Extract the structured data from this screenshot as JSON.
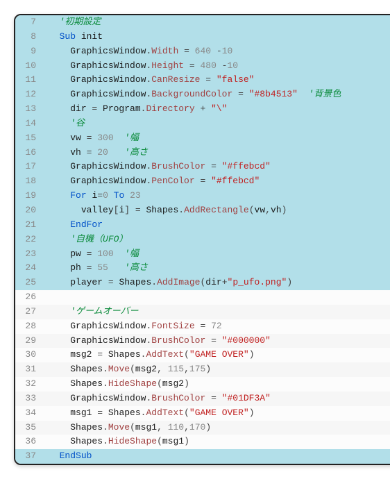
{
  "lines": [
    {
      "num": 7,
      "hl": true,
      "indent": 1,
      "tokens": [
        [
          "comment",
          "'初期設定"
        ]
      ]
    },
    {
      "num": 8,
      "hl": true,
      "indent": 1,
      "tokens": [
        [
          "keyword",
          "Sub "
        ],
        [
          "ident",
          "init"
        ]
      ]
    },
    {
      "num": 9,
      "hl": true,
      "indent": 2,
      "tokens": [
        [
          "ident",
          "GraphicsWindow"
        ],
        [
          "op",
          "."
        ],
        [
          "prop",
          "Width"
        ],
        [
          "op",
          " = "
        ],
        [
          "num",
          "640"
        ],
        [
          "op",
          " -"
        ],
        [
          "num",
          "10"
        ]
      ]
    },
    {
      "num": 10,
      "hl": true,
      "indent": 2,
      "tokens": [
        [
          "ident",
          "GraphicsWindow"
        ],
        [
          "op",
          "."
        ],
        [
          "prop",
          "Height"
        ],
        [
          "op",
          " = "
        ],
        [
          "num",
          "480"
        ],
        [
          "op",
          " -"
        ],
        [
          "num",
          "10"
        ]
      ]
    },
    {
      "num": 11,
      "hl": true,
      "indent": 2,
      "tokens": [
        [
          "ident",
          "GraphicsWindow"
        ],
        [
          "op",
          "."
        ],
        [
          "prop",
          "CanResize"
        ],
        [
          "op",
          " = "
        ],
        [
          "str",
          "\"false\""
        ]
      ]
    },
    {
      "num": 12,
      "hl": true,
      "indent": 2,
      "tokens": [
        [
          "ident",
          "GraphicsWindow"
        ],
        [
          "op",
          "."
        ],
        [
          "prop",
          "BackgroundColor"
        ],
        [
          "op",
          " = "
        ],
        [
          "str",
          "\"#8b4513\""
        ],
        [
          "op",
          "  "
        ],
        [
          "comment",
          "'背景色"
        ]
      ]
    },
    {
      "num": 13,
      "hl": true,
      "indent": 2,
      "tokens": [
        [
          "ident",
          "dir"
        ],
        [
          "op",
          " = "
        ],
        [
          "ident",
          "Program"
        ],
        [
          "op",
          "."
        ],
        [
          "prop",
          "Directory"
        ],
        [
          "op",
          " + "
        ],
        [
          "str",
          "\"\\\""
        ]
      ]
    },
    {
      "num": 14,
      "hl": true,
      "indent": 2,
      "tokens": [
        [
          "comment",
          "'谷"
        ]
      ]
    },
    {
      "num": 15,
      "hl": true,
      "indent": 2,
      "tokens": [
        [
          "ident",
          "vw"
        ],
        [
          "op",
          " = "
        ],
        [
          "num",
          "300"
        ],
        [
          "op",
          "  "
        ],
        [
          "comment",
          "'幅"
        ]
      ]
    },
    {
      "num": 16,
      "hl": true,
      "indent": 2,
      "tokens": [
        [
          "ident",
          "vh"
        ],
        [
          "op",
          " = "
        ],
        [
          "num",
          "20"
        ],
        [
          "op",
          "   "
        ],
        [
          "comment",
          "'高さ"
        ]
      ]
    },
    {
      "num": 17,
      "hl": true,
      "indent": 2,
      "tokens": [
        [
          "ident",
          "GraphicsWindow"
        ],
        [
          "op",
          "."
        ],
        [
          "prop",
          "BrushColor"
        ],
        [
          "op",
          " = "
        ],
        [
          "str",
          "\"#ffebcd\""
        ]
      ]
    },
    {
      "num": 18,
      "hl": true,
      "indent": 2,
      "tokens": [
        [
          "ident",
          "GraphicsWindow"
        ],
        [
          "op",
          "."
        ],
        [
          "prop",
          "PenColor"
        ],
        [
          "op",
          " = "
        ],
        [
          "str",
          "\"#ffebcd\""
        ]
      ]
    },
    {
      "num": 19,
      "hl": true,
      "indent": 2,
      "tokens": [
        [
          "keyword",
          "For "
        ],
        [
          "ident",
          "i"
        ],
        [
          "op",
          "="
        ],
        [
          "num",
          "0"
        ],
        [
          "keyword",
          " To "
        ],
        [
          "num",
          "23"
        ]
      ]
    },
    {
      "num": 20,
      "hl": true,
      "indent": 3,
      "tokens": [
        [
          "ident",
          "valley"
        ],
        [
          "op",
          "["
        ],
        [
          "ident",
          "i"
        ],
        [
          "op",
          "]"
        ],
        [
          "op",
          " = "
        ],
        [
          "ident",
          "Shapes"
        ],
        [
          "op",
          "."
        ],
        [
          "prop",
          "AddRectangle"
        ],
        [
          "op",
          "("
        ],
        [
          "ident",
          "vw"
        ],
        [
          "op",
          ","
        ],
        [
          "ident",
          "vh"
        ],
        [
          "op",
          ")"
        ]
      ]
    },
    {
      "num": 21,
      "hl": true,
      "indent": 2,
      "tokens": [
        [
          "keyword",
          "EndFor"
        ]
      ]
    },
    {
      "num": 22,
      "hl": true,
      "indent": 2,
      "tokens": [
        [
          "comment",
          "'自機（UFO）"
        ]
      ]
    },
    {
      "num": 23,
      "hl": true,
      "indent": 2,
      "tokens": [
        [
          "ident",
          "pw"
        ],
        [
          "op",
          " = "
        ],
        [
          "num",
          "100"
        ],
        [
          "op",
          "  "
        ],
        [
          "comment",
          "'幅"
        ]
      ]
    },
    {
      "num": 24,
      "hl": true,
      "indent": 2,
      "tokens": [
        [
          "ident",
          "ph"
        ],
        [
          "op",
          " = "
        ],
        [
          "num",
          "55"
        ],
        [
          "op",
          "   "
        ],
        [
          "comment",
          "'高さ"
        ]
      ]
    },
    {
      "num": 25,
      "hl": true,
      "indent": 2,
      "tokens": [
        [
          "ident",
          "player"
        ],
        [
          "op",
          " = "
        ],
        [
          "ident",
          "Shapes"
        ],
        [
          "op",
          "."
        ],
        [
          "prop",
          "AddImage"
        ],
        [
          "op",
          "("
        ],
        [
          "ident",
          "dir"
        ],
        [
          "op",
          "+"
        ],
        [
          "str",
          "\"p_ufo.png\""
        ],
        [
          "op",
          ")"
        ]
      ]
    },
    {
      "num": 26,
      "hl": false,
      "indent": 0,
      "tokens": []
    },
    {
      "num": 27,
      "hl": false,
      "indent": 2,
      "tokens": [
        [
          "comment",
          "'ゲームオーバー"
        ]
      ]
    },
    {
      "num": 28,
      "hl": false,
      "indent": 2,
      "tokens": [
        [
          "ident",
          "GraphicsWindow"
        ],
        [
          "op",
          "."
        ],
        [
          "prop",
          "FontSize"
        ],
        [
          "op",
          " = "
        ],
        [
          "num",
          "72"
        ]
      ]
    },
    {
      "num": 29,
      "hl": false,
      "indent": 2,
      "tokens": [
        [
          "ident",
          "GraphicsWindow"
        ],
        [
          "op",
          "."
        ],
        [
          "prop",
          "BrushColor"
        ],
        [
          "op",
          " = "
        ],
        [
          "str",
          "\"#000000\""
        ]
      ]
    },
    {
      "num": 30,
      "hl": false,
      "indent": 2,
      "tokens": [
        [
          "ident",
          "msg2"
        ],
        [
          "op",
          " = "
        ],
        [
          "ident",
          "Shapes"
        ],
        [
          "op",
          "."
        ],
        [
          "prop",
          "AddText"
        ],
        [
          "op",
          "("
        ],
        [
          "str",
          "\"GAME OVER\""
        ],
        [
          "op",
          ")"
        ]
      ]
    },
    {
      "num": 31,
      "hl": false,
      "indent": 2,
      "tokens": [
        [
          "ident",
          "Shapes"
        ],
        [
          "op",
          "."
        ],
        [
          "prop",
          "Move"
        ],
        [
          "op",
          "("
        ],
        [
          "ident",
          "msg2"
        ],
        [
          "op",
          ", "
        ],
        [
          "num",
          "115"
        ],
        [
          "op",
          ","
        ],
        [
          "num",
          "175"
        ],
        [
          "op",
          ")"
        ]
      ]
    },
    {
      "num": 32,
      "hl": false,
      "indent": 2,
      "tokens": [
        [
          "ident",
          "Shapes"
        ],
        [
          "op",
          "."
        ],
        [
          "prop",
          "HideShape"
        ],
        [
          "op",
          "("
        ],
        [
          "ident",
          "msg2"
        ],
        [
          "op",
          ")"
        ]
      ]
    },
    {
      "num": 33,
      "hl": false,
      "indent": 2,
      "tokens": [
        [
          "ident",
          "GraphicsWindow"
        ],
        [
          "op",
          "."
        ],
        [
          "prop",
          "BrushColor"
        ],
        [
          "op",
          " = "
        ],
        [
          "str",
          "\"#01DF3A\""
        ]
      ]
    },
    {
      "num": 34,
      "hl": false,
      "indent": 2,
      "tokens": [
        [
          "ident",
          "msg1"
        ],
        [
          "op",
          " = "
        ],
        [
          "ident",
          "Shapes"
        ],
        [
          "op",
          "."
        ],
        [
          "prop",
          "AddText"
        ],
        [
          "op",
          "("
        ],
        [
          "str",
          "\"GAME OVER\""
        ],
        [
          "op",
          ")"
        ]
      ]
    },
    {
      "num": 35,
      "hl": false,
      "indent": 2,
      "tokens": [
        [
          "ident",
          "Shapes"
        ],
        [
          "op",
          "."
        ],
        [
          "prop",
          "Move"
        ],
        [
          "op",
          "("
        ],
        [
          "ident",
          "msg1"
        ],
        [
          "op",
          ", "
        ],
        [
          "num",
          "110"
        ],
        [
          "op",
          ","
        ],
        [
          "num",
          "170"
        ],
        [
          "op",
          ")"
        ]
      ]
    },
    {
      "num": 36,
      "hl": false,
      "indent": 2,
      "tokens": [
        [
          "ident",
          "Shapes"
        ],
        [
          "op",
          "."
        ],
        [
          "prop",
          "HideShape"
        ],
        [
          "op",
          "("
        ],
        [
          "ident",
          "msg1"
        ],
        [
          "op",
          ")"
        ]
      ]
    },
    {
      "num": 37,
      "hl": true,
      "indent": 1,
      "tokens": [
        [
          "keyword",
          "EndSub"
        ]
      ]
    }
  ],
  "indent_unit": "  ",
  "token_class_map": {
    "comment": "c-comment",
    "keyword": "c-keyword",
    "ident": "c-ident",
    "prop": "c-prop",
    "op": "c-op",
    "num": "c-num",
    "str": "c-str"
  }
}
